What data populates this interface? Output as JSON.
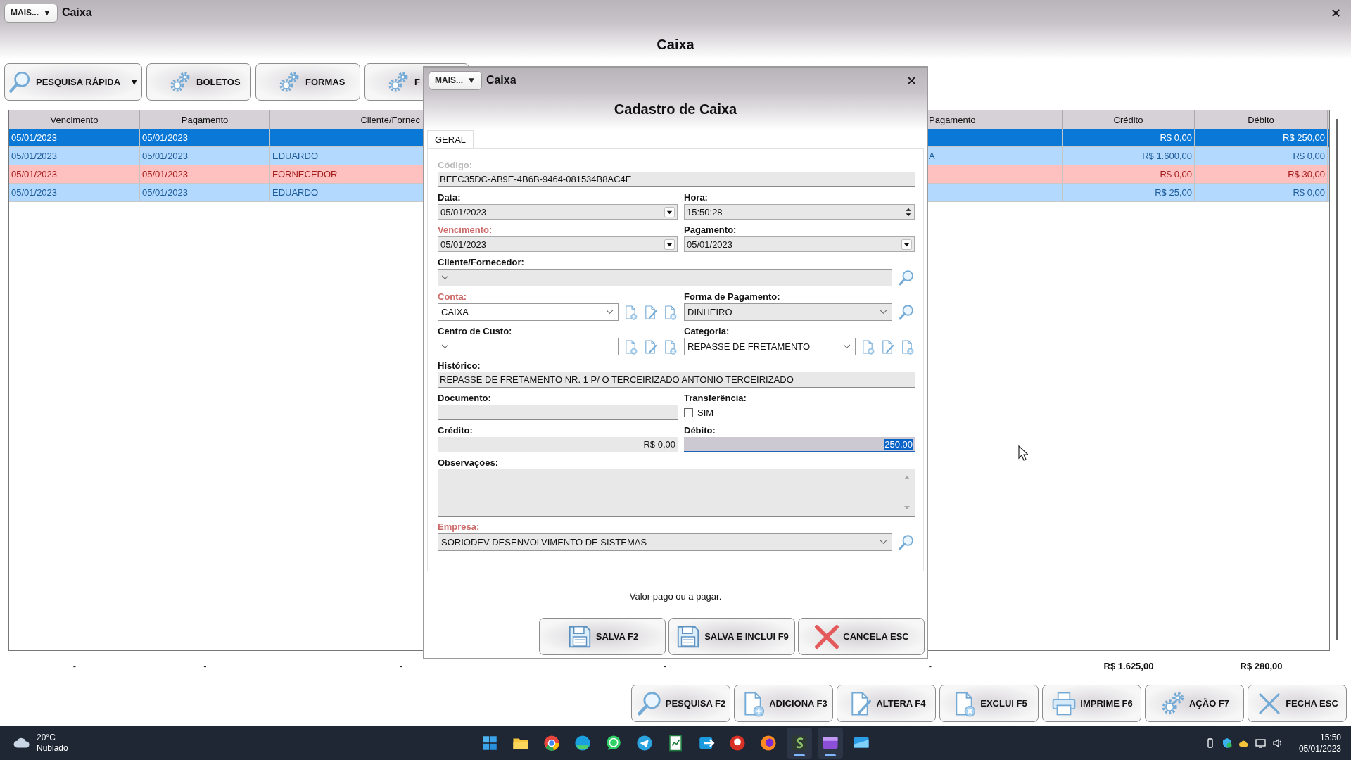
{
  "window": {
    "menu_button": "MAIS...",
    "menu_caret": "▼",
    "title": "Caixa",
    "close": "✕",
    "heading": "Caixa"
  },
  "toolbar": [
    {
      "label": "PESQUISA RÁPIDA",
      "kind": "search",
      "caret": "▼"
    },
    {
      "label": "BOLETOS",
      "kind": "settings"
    },
    {
      "label": "FORMAS",
      "kind": "settings"
    },
    {
      "label": "F",
      "kind": "settings"
    }
  ],
  "table": {
    "columns": [
      "Vencimento",
      "Pagamento",
      "Cliente/Fornec",
      null,
      "Pagamento",
      "Crédito",
      "Débito"
    ],
    "rows": [
      {
        "kind": "debit",
        "selected": true,
        "cells": [
          "05/01/2023",
          "05/01/2023",
          null,
          null,
          null,
          "R$ 0,00",
          "R$ 250,00"
        ]
      },
      {
        "kind": "credit",
        "selected": false,
        "cells": [
          "05/01/2023",
          "05/01/2023",
          "EDUARDO",
          null,
          "A",
          "R$ 1.600,00",
          "R$ 0,00"
        ]
      },
      {
        "kind": "debit",
        "selected": false,
        "cells": [
          "05/01/2023",
          "05/01/2023",
          "FORNECEDOR",
          null,
          null,
          "R$ 0,00",
          "R$ 30,00"
        ]
      },
      {
        "kind": "credit",
        "selected": false,
        "cells": [
          "05/01/2023",
          "05/01/2023",
          "EDUARDO",
          null,
          null,
          "R$ 25,00",
          "R$ 0,00"
        ]
      }
    ],
    "totals": [
      "-",
      "-",
      "-",
      "-",
      "-",
      "R$ 1.625,00",
      "R$ 280,00"
    ]
  },
  "actions": [
    {
      "label": "PESQUISA F2",
      "kind": "search"
    },
    {
      "label": "ADICIONA F3",
      "kind": "add"
    },
    {
      "label": "ALTERA F4",
      "kind": "edit"
    },
    {
      "label": "EXCLUI F5",
      "kind": "delete"
    },
    {
      "label": "IMPRIME F6",
      "kind": "print"
    },
    {
      "label": "AÇÃO F7",
      "kind": "action"
    },
    {
      "label": "FECHA ESC",
      "kind": "close"
    }
  ],
  "dialog": {
    "menu_button": "MAIS...",
    "menu_caret": "▼",
    "title": "Caixa",
    "close": "✕",
    "heading": "Cadastro de Caixa",
    "tabs": [
      {
        "label": "GERAL",
        "selected": true
      }
    ],
    "rows": [
      [
        {
          "label": "Código:",
          "kind": "text",
          "value": "BEFC35DC-AB9E-4B6B-9464-081534B8AC4E",
          "required": false,
          "disabled": true,
          "focused": false
        }
      ],
      [
        {
          "label": "Data:",
          "kind": "date",
          "value": "05/01/2023",
          "required": false,
          "disabled": false,
          "focused": false
        },
        {
          "label": "Hora:",
          "kind": "time",
          "value": "15:50:28",
          "required": false,
          "disabled": false,
          "focused": false
        }
      ],
      [
        {
          "label": "Vencimento:",
          "kind": "date",
          "value": "05/01/2023",
          "required": true,
          "disabled": false,
          "focused": false
        },
        {
          "label": "Pagamento:",
          "kind": "date",
          "value": "05/01/2023",
          "required": false,
          "disabled": false,
          "focused": false
        }
      ],
      [
        {
          "label": "Cliente/Fornecedor:",
          "kind": "combo",
          "lookup": true,
          "crud": false,
          "required": false,
          "disabled": false,
          "focused": false
        }
      ],
      [
        {
          "label": "Conta:",
          "kind": "combo",
          "value": "CAIXA",
          "lookup": false,
          "crud": true,
          "required": true,
          "disabled": false,
          "focused": false
        },
        {
          "label": "Forma de Pagamento:",
          "kind": "combo",
          "value": "DINHEIRO",
          "lookup": true,
          "crud": false,
          "required": false,
          "disabled": false,
          "focused": false
        }
      ],
      [
        {
          "label": "Centro de Custo:",
          "kind": "combo",
          "lookup": false,
          "crud": true,
          "required": false,
          "disabled": false,
          "focused": false
        },
        {
          "label": "Categoria:",
          "kind": "combo",
          "value": "REPASSE DE FRETAMENTO",
          "lookup": false,
          "crud": true,
          "required": false,
          "disabled": false,
          "focused": false
        }
      ],
      [
        {
          "label": "Histórico:",
          "kind": "text",
          "value": "REPASSE DE FRETAMENTO NR. 1 P/ O TERCEIRIZADO ANTONIO TERCEIRIZADO",
          "required": false,
          "disabled": false,
          "focused": false
        }
      ],
      [
        {
          "label": "Documento:",
          "kind": "text",
          "required": false,
          "disabled": false,
          "focused": false
        },
        {
          "label": "Transferência:",
          "kind": "checkbox",
          "option": "SIM",
          "checked": false,
          "required": false,
          "disabled": false,
          "focused": false
        }
      ],
      [
        {
          "label": "Crédito:",
          "kind": "money",
          "value": "R$ 0,00",
          "required": false,
          "disabled": false,
          "focused": false
        },
        {
          "label": "Débito:",
          "kind": "money",
          "value": "250,00",
          "required": false,
          "disabled": false,
          "focused": true
        }
      ],
      [
        {
          "label": "Observações:",
          "kind": "memo",
          "required": false,
          "disabled": false,
          "focused": false
        }
      ],
      [
        {
          "label": "Empresa:",
          "kind": "combo",
          "value": "SORIODEV DESENVOLVIMENTO DE SISTEMAS",
          "lookup": true,
          "crud": false,
          "required": true,
          "disabled": false,
          "focused": false
        }
      ]
    ],
    "hint": "Valor pago ou a pagar.",
    "buttons": [
      {
        "label": "SALVA F2",
        "kind": "save"
      },
      {
        "label": "SALVA E INCLUI F9",
        "kind": "save-new"
      },
      {
        "label": "CANCELA ESC",
        "kind": "cancel"
      }
    ]
  },
  "taskbar": {
    "weather": {
      "temperature": "20°C",
      "condition": "Nublado"
    },
    "apps": [
      {
        "kind": "start",
        "running": false
      },
      {
        "kind": "folder",
        "running": false
      },
      {
        "kind": "chrome",
        "running": false
      },
      {
        "kind": "edge",
        "running": false
      },
      {
        "kind": "whatsapp",
        "running": false
      },
      {
        "kind": "telegram",
        "running": false
      },
      {
        "kind": "sheet",
        "running": false
      },
      {
        "kind": "transfer",
        "running": false
      },
      {
        "kind": "app",
        "running": false
      },
      {
        "kind": "firefox",
        "running": false
      },
      {
        "kind": "sorio",
        "running": true
      },
      {
        "kind": "video",
        "running": true
      },
      {
        "kind": "remote",
        "running": false
      }
    ],
    "time": "15:50",
    "date": "05/01/2023"
  }
}
